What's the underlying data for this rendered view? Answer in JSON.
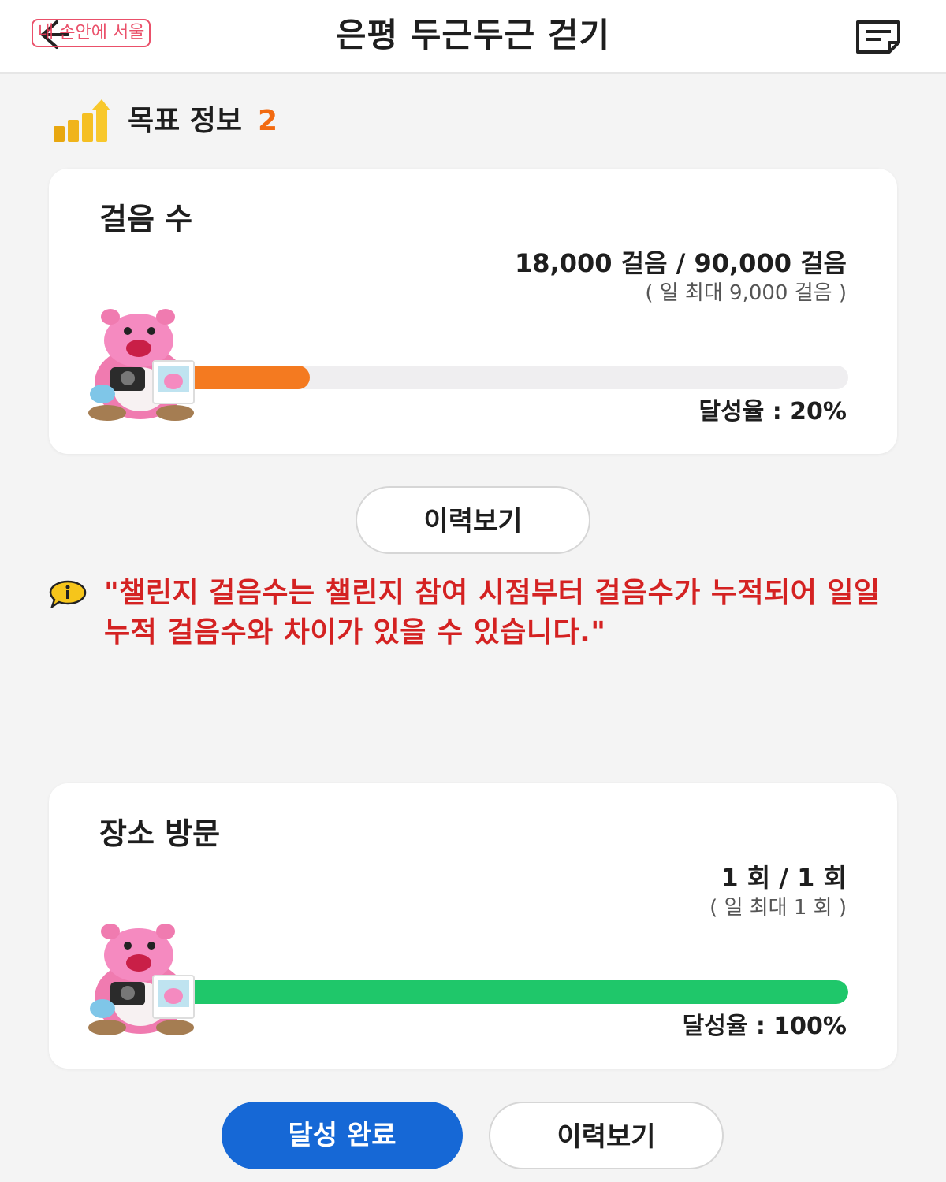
{
  "header": {
    "title": "은평 두근두근 걷기",
    "watermark": "내 손안에 서울"
  },
  "section": {
    "title": "목표 정보",
    "count": "2"
  },
  "goals": [
    {
      "title": "걸음 수",
      "value": "18,000 걸음 / 90,000 걸음",
      "sub": "( 일 최대 9,000 걸음 )",
      "rate_label": "달성율 : 20%",
      "progress": 0.2,
      "bar_color": "#f47a20"
    },
    {
      "title": "장소 방문",
      "value": "1 회 / 1 회",
      "sub": "( 일 최대 1 회 )",
      "rate_label": "달성율 : 100%",
      "progress": 1.0,
      "bar_color": "#1fc76a"
    }
  ],
  "buttons": {
    "history": "이력보기",
    "complete": "달성 완료"
  },
  "notice": {
    "text": "\"챌린지 걸음수는 챌린지 참여 시점부터 걸음수가 누적되어 일일 누적 걸음수와 차이가 있을 수 있습니다.\""
  },
  "colors": {
    "accent_orange": "#f26a10",
    "primary_blue": "#1668d6",
    "notice_red": "#d42222"
  },
  "icons": {
    "back": "back-arrow-icon",
    "memo": "memo-icon",
    "section": "bar-chart-up-icon",
    "info": "info-icon",
    "mascot": "pink-mascot-character"
  }
}
